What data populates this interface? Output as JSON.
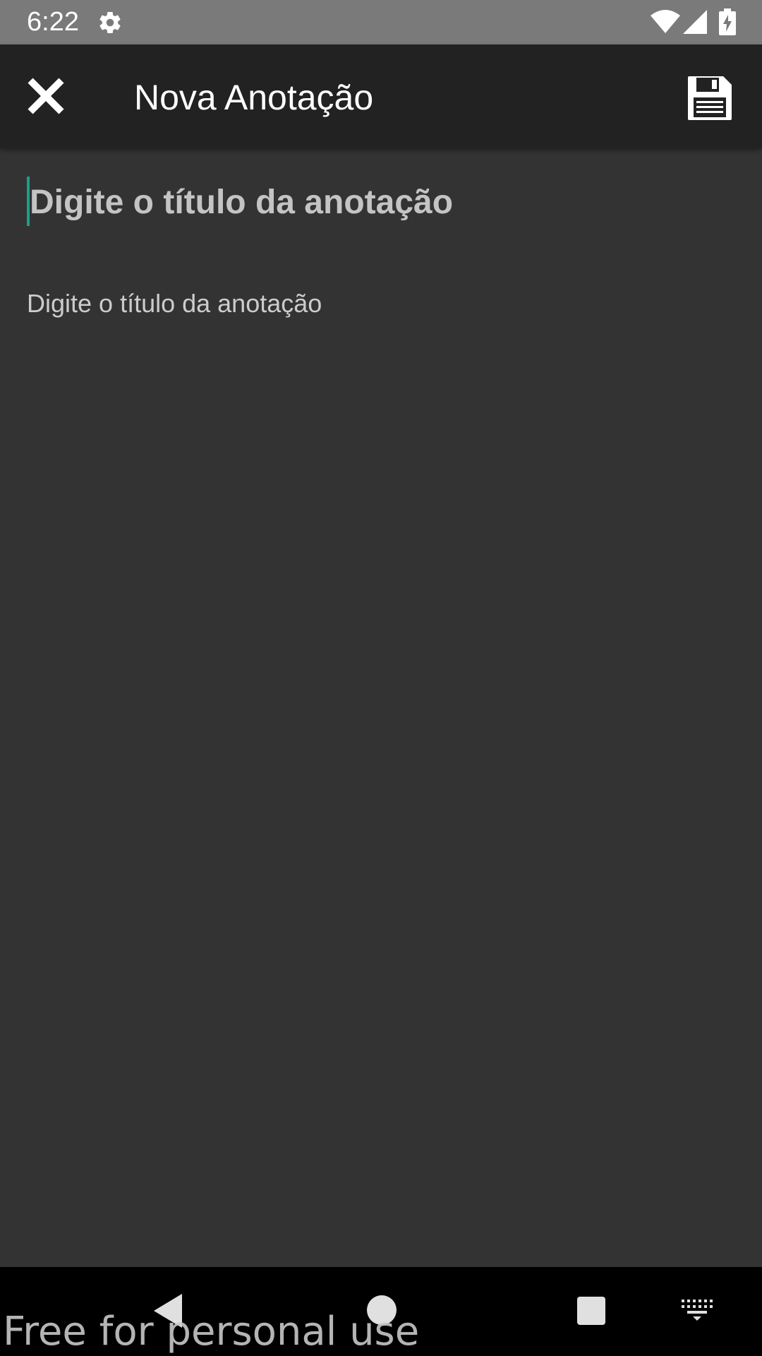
{
  "status_bar": {
    "time": "6:22",
    "icons": [
      "gear-icon",
      "wifi-icon",
      "signal-icon",
      "battery-charging-icon"
    ]
  },
  "app_bar": {
    "title": "Nova Anotação",
    "close_icon": "close-icon",
    "save_icon": "floppy-disk-save-icon"
  },
  "editor": {
    "title_placeholder": "Digite o título da anotação",
    "title_value": "",
    "body_placeholder": "Digite o título da anotação",
    "body_value": ""
  },
  "nav_bar": {
    "icons": [
      "back-icon",
      "home-icon",
      "recents-icon",
      "keyboard-icon"
    ]
  },
  "watermark": "Free for personal use",
  "colors": {
    "status_bar": "#7a7a7a",
    "app_bar": "#222222",
    "background": "#333333",
    "accent": "#1a9e8f",
    "nav_bar": "#000000"
  }
}
